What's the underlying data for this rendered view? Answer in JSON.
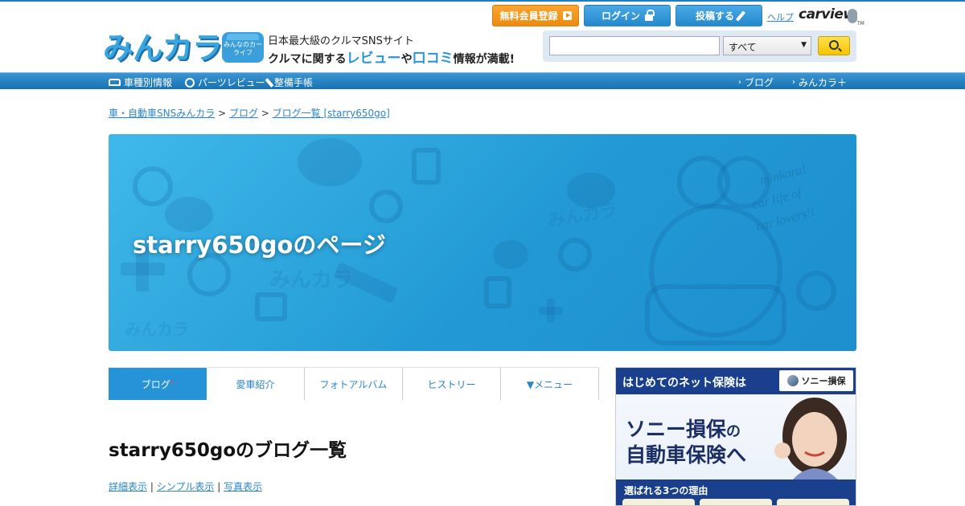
{
  "header": {
    "logo_text": "みんカラ",
    "logo_tm": "TM",
    "carlife_text": "みんなのカーライフ",
    "tagline1": "日本最大級のクルマSNSサイト",
    "tagline2_a": "クルマに関する",
    "tagline2_b": "レビュー",
    "tagline2_c": "や",
    "tagline2_d": "口コミ",
    "tagline2_e": "情報が満載!",
    "register_label": "無料会員登録",
    "login_label": "ログイン",
    "post_label": "投稿する",
    "help_label": "ヘルプ",
    "carview_label": "carview",
    "carview_tm": "TM"
  },
  "search": {
    "placeholder": "",
    "category_value": "すべて"
  },
  "gnav": {
    "left": [
      {
        "label": "車種別情報",
        "icon": "car-icon"
      },
      {
        "label": "パーツレビュー",
        "icon": "gear-icon"
      },
      {
        "label": "整備手帳",
        "icon": "wrench-icon"
      }
    ],
    "right": [
      {
        "label": "ブログ"
      },
      {
        "label": "みんカラ＋"
      }
    ]
  },
  "breadcrumb": {
    "items": [
      "車・自動車SNSみんカラ",
      "ブログ",
      "ブログ一覧 [starry650go]"
    ],
    "separator": ">"
  },
  "hero": {
    "title": "starry650goのページ",
    "bg_colors": [
      "#3fb8ea",
      "#1d8fcf"
    ],
    "watermark_text": "minkara! car life of car lovers!!"
  },
  "tabs": [
    {
      "label": "ブログ",
      "active": true,
      "marker": "*"
    },
    {
      "label": "愛車紹介",
      "active": false
    },
    {
      "label": "フォトアルバム",
      "active": false
    },
    {
      "label": "ヒストリー",
      "active": false
    },
    {
      "label": "▼メニュー",
      "active": false
    }
  ],
  "main": {
    "heading": "starry650goのブログ一覧",
    "view_links": [
      "詳細表示",
      "シンプル表示",
      "写真表示"
    ],
    "view_sep": "|"
  },
  "ad": {
    "top_text": "はじめてのネット保険は",
    "brand": "ソニー損保",
    "line1_a": "ソニー損保",
    "line1_b": "の",
    "line2": "自動車保険へ",
    "bar_text": "選ばれる3つの理由",
    "colors": {
      "navy": "#1a3f8c"
    }
  },
  "colors": {
    "accent": "#2593d6",
    "link": "#2a86c8",
    "register": "#ee8a0f",
    "search_btn": "#f7c400"
  }
}
